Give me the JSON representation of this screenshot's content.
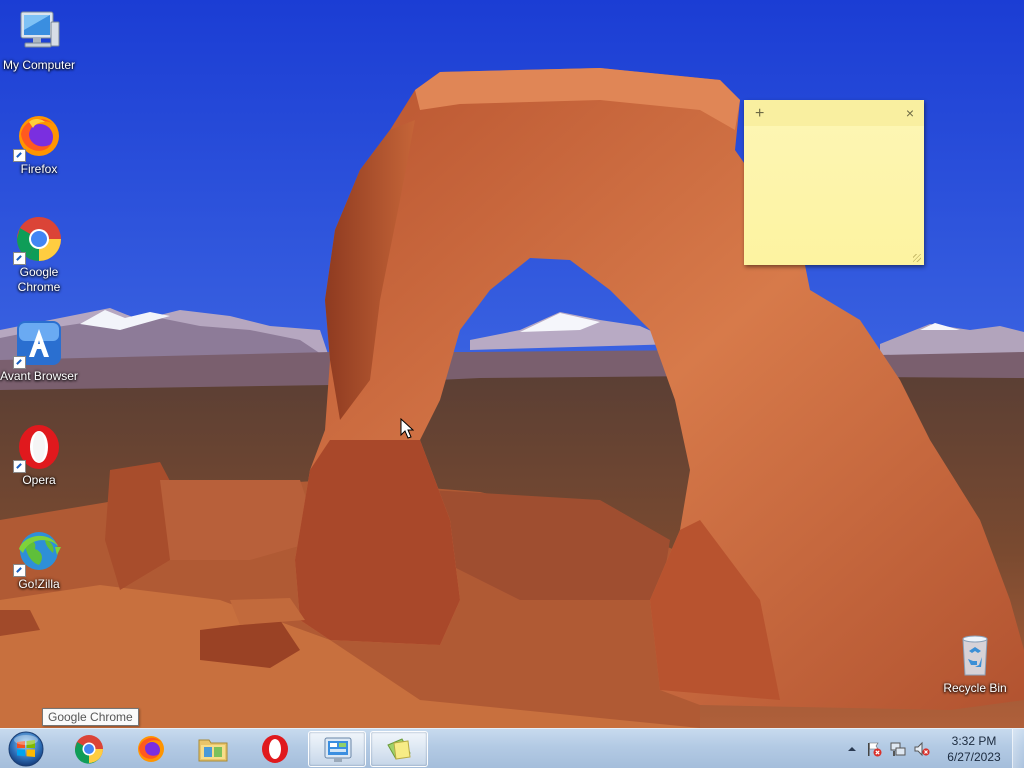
{
  "desktop": {
    "icons": [
      {
        "label": "My Computer",
        "icon": "computer-icon"
      },
      {
        "label": "Firefox",
        "icon": "firefox-icon"
      },
      {
        "label": "Google Chrome",
        "icon": "chrome-icon"
      },
      {
        "label": "Avant Browser",
        "icon": "avant-browser-icon"
      },
      {
        "label": "Opera",
        "icon": "opera-icon"
      },
      {
        "label": "Go!Zilla",
        "icon": "gozilla-icon"
      },
      {
        "label": "Recycle Bin",
        "icon": "recycle-bin-icon"
      }
    ]
  },
  "sticky_note": {
    "add_symbol": "+",
    "close_symbol": "×",
    "text": ""
  },
  "tooltip": {
    "text": "Google Chrome"
  },
  "taskbar": {
    "start_button": "windows-orb-icon",
    "pinned": [
      {
        "app": "Google Chrome",
        "icon": "chrome-icon"
      },
      {
        "app": "Firefox",
        "icon": "firefox-icon"
      },
      {
        "app": "File Explorer",
        "icon": "folder-icon"
      },
      {
        "app": "Opera",
        "icon": "opera-icon"
      },
      {
        "app": "Control Panel",
        "icon": "control-panel-icon",
        "active": true
      },
      {
        "app": "Sticky Notes",
        "icon": "sticky-notes-icon",
        "active": true
      }
    ],
    "tray": {
      "icons": [
        "show-hidden-icons-arrow",
        "action-center-flag-icon",
        "network-icon",
        "volume-muted-icon"
      ],
      "time": "3:32 PM",
      "date": "6/27/2023"
    }
  },
  "colors": {
    "sky_top": "#1d3fd6",
    "sky_bottom": "#7f9ce6",
    "rock": "#c8643a",
    "sticky": "#fdf3a0",
    "taskbar": "#b3cae4"
  }
}
